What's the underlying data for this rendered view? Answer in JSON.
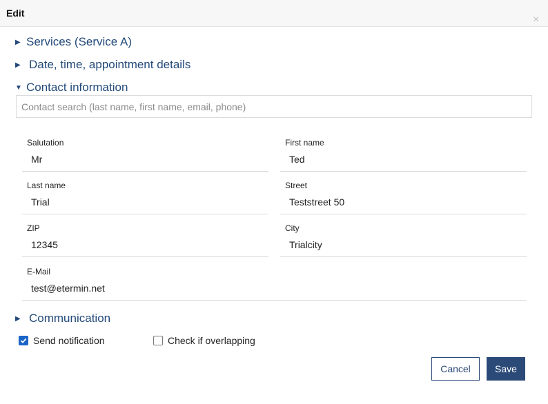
{
  "dialog": {
    "title": "Edit",
    "close_label": "×"
  },
  "sections": {
    "services": {
      "label": "Services (Service A)",
      "expanded": false
    },
    "datetime": {
      "label": "Date, time, appointment details",
      "expanded": false
    },
    "contact": {
      "label": "Contact information",
      "expanded": true
    },
    "communication": {
      "label": "Communication",
      "expanded": false
    }
  },
  "contact_search": {
    "placeholder": "Contact search (last name, first name, email, phone)",
    "value": ""
  },
  "fields": {
    "salutation": {
      "label": "Salutation",
      "value": "Mr"
    },
    "first_name": {
      "label": "First name",
      "value": "Ted"
    },
    "last_name": {
      "label": "Last name",
      "value": "Trial"
    },
    "street": {
      "label": "Street",
      "value": "Teststreet 50"
    },
    "zip": {
      "label": "ZIP",
      "value": "12345"
    },
    "city": {
      "label": "City",
      "value": "Trialcity"
    },
    "email": {
      "label": "E-Mail",
      "value": "test@etermin.net"
    }
  },
  "options": {
    "send_notification": {
      "label": "Send notification",
      "checked": true
    },
    "check_overlapping": {
      "label": "Check if overlapping",
      "checked": false
    }
  },
  "buttons": {
    "cancel": "Cancel",
    "save": "Save"
  },
  "colors": {
    "accent": "#234a7a",
    "button": "#2c4a78",
    "checkbox": "#1a64c8"
  }
}
